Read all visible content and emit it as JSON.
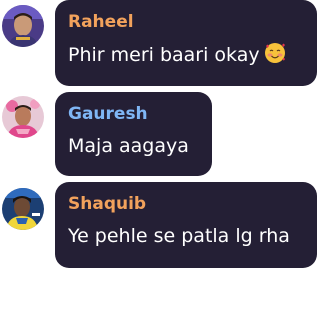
{
  "messages": [
    {
      "sender": "Raheel",
      "name_color": "#f2a25c",
      "text": "Phir meri baari okay",
      "emoji": "smiling-face-with-hearts-icon"
    },
    {
      "sender": "Gauresh",
      "name_color": "#7fb6f5",
      "text": "Maja aagaya"
    },
    {
      "sender": "Shaquib",
      "name_color": "#f2a25c",
      "text": "Ye pehle se patla lg rha"
    }
  ]
}
